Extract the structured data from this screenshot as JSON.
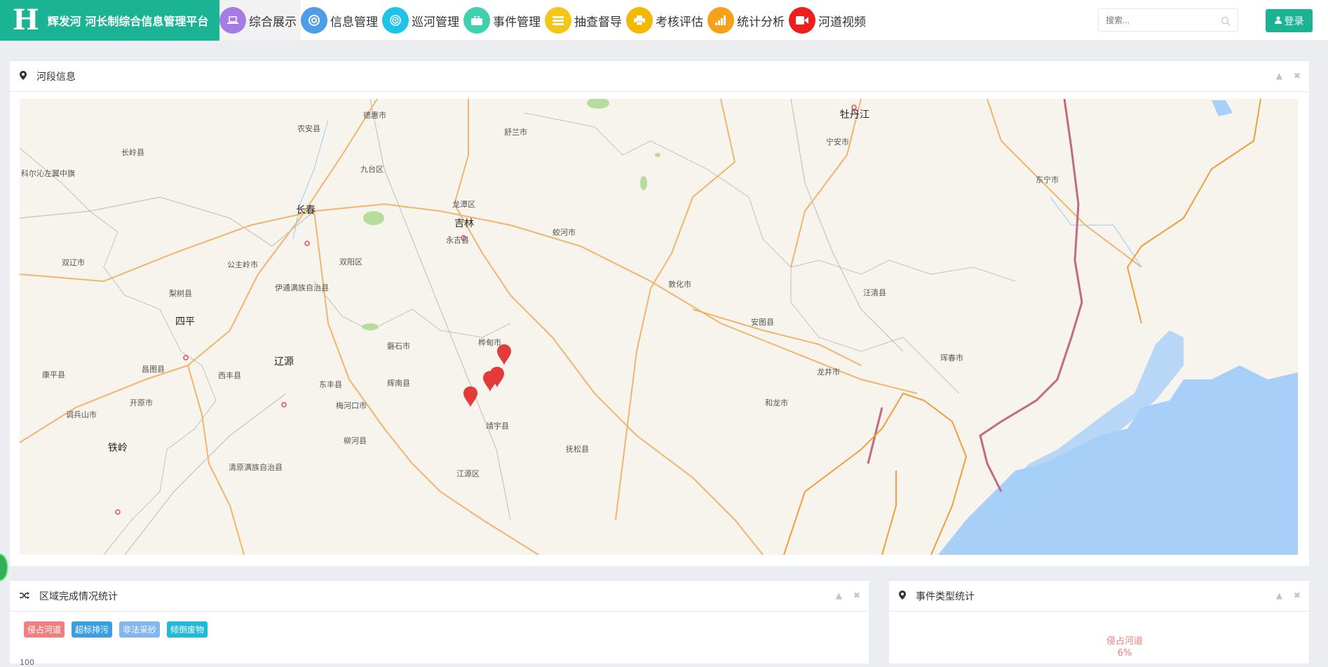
{
  "header": {
    "logo_letter": "H",
    "title": "辉发河 河长制综合信息管理平台",
    "search_placeholder": "搜索...",
    "login_label": "登录"
  },
  "nav": [
    {
      "label": "综合展示",
      "icon": "laptop-icon",
      "color": "#a77be4",
      "active": true
    },
    {
      "label": "信息管理",
      "icon": "lifebuoy-icon",
      "color": "#4d9ee6",
      "active": false
    },
    {
      "label": "巡河管理",
      "icon": "target-icon",
      "color": "#1fc3e8",
      "active": false
    },
    {
      "label": "事件管理",
      "icon": "briefcase-icon",
      "color": "#3fd1ad",
      "active": false
    },
    {
      "label": "抽查督导",
      "icon": "list-icon",
      "color": "#f5c518",
      "active": false
    },
    {
      "label": "考核评估",
      "icon": "print-icon",
      "color": "#f5b800",
      "active": false
    },
    {
      "label": "统计分析",
      "icon": "signal-icon",
      "color": "#f7a118",
      "active": false
    },
    {
      "label": "河道视频",
      "icon": "video-icon",
      "color": "#f01d1d",
      "active": false
    }
  ],
  "panels": {
    "river": {
      "title": "河段信息",
      "icon": "map-marker-icon"
    },
    "region": {
      "title": "区域完成情况统计",
      "icon": "random-icon",
      "y_tick": "100"
    },
    "events": {
      "title": "事件类型统计",
      "icon": "map-marker-icon",
      "pie_label": "侵占河道",
      "pie_pct": "6%"
    }
  },
  "legend_tags": [
    {
      "label": "侵占河道",
      "color": "#f08080"
    },
    {
      "label": "超标排污",
      "color": "#3b9ee0"
    },
    {
      "label": "非法采砂",
      "color": "#82b7ed"
    },
    {
      "label": "倾倒废物",
      "color": "#22b8d8"
    }
  ],
  "map": {
    "cities_major": [
      "长春",
      "吉林",
      "四平",
      "辽源",
      "铁岭",
      "牡丹江"
    ],
    "places": [
      "德惠市",
      "农安县",
      "舒兰市",
      "长岭县",
      "科尔沁左翼中旗",
      "九台区",
      "龙潭区",
      "永吉县",
      "蛟河市",
      "宁安市",
      "东宁市",
      "双辽市",
      "公主岭市",
      "双阳区",
      "梨树县",
      "伊通满族自治县",
      "敦化市",
      "汪清县",
      "安图县",
      "桦甸市",
      "磐石市",
      "珲春市",
      "龙井市",
      "昌图县",
      "西丰县",
      "东丰县",
      "辉南县",
      "康平县",
      "开原市",
      "梅河口市",
      "和龙市",
      "调兵山市",
      "柳河县",
      "靖宇县",
      "抚松县",
      "清原满族自治县",
      "江源区"
    ]
  }
}
